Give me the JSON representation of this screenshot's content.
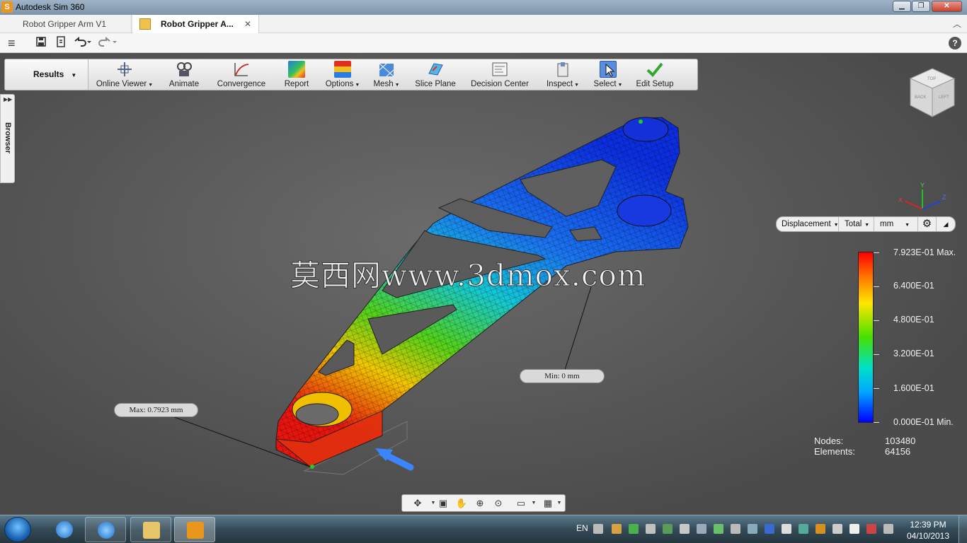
{
  "window": {
    "title": "Autodesk Sim 360",
    "minimize": "▁",
    "maximize": "❐",
    "close": "✕"
  },
  "tabs": [
    {
      "label": "Robot Gripper Arm V1"
    },
    {
      "label": "Robot Gripper A...",
      "close": "✕"
    }
  ],
  "quick_access": {
    "menu": "≡",
    "help": "?"
  },
  "ribbon": {
    "workspace": "Results",
    "items": [
      {
        "label": "Online Viewer",
        "dropdown": true
      },
      {
        "label": "Animate",
        "dropdown": false
      },
      {
        "label": "Convergence",
        "dropdown": false
      },
      {
        "label": "Report",
        "dropdown": false
      },
      {
        "label": "Options",
        "dropdown": true
      },
      {
        "label": "Mesh",
        "dropdown": true
      },
      {
        "label": "Slice Plane",
        "dropdown": false
      },
      {
        "label": "Decision Center",
        "dropdown": false
      },
      {
        "label": "Inspect",
        "dropdown": true
      },
      {
        "label": "Select",
        "dropdown": true
      },
      {
        "label": "Edit Setup",
        "dropdown": false
      }
    ]
  },
  "browser": {
    "label": "Browser"
  },
  "viewcube": {
    "top": "TOP",
    "front": "BACK",
    "right": "LEFT"
  },
  "legend_controls": {
    "result": "Displacement",
    "component": "Total",
    "unit": "mm"
  },
  "legend": {
    "labels": [
      "7.923E-01 Max.",
      "6.400E-01",
      "4.800E-01",
      "3.200E-01",
      "1.600E-01",
      "0.000E-01 Min."
    ],
    "colors": {
      "max": "#ff0000",
      "min": "#0000ff"
    }
  },
  "stats": {
    "nodes_label": "Nodes:",
    "nodes_value": "103480",
    "elements_label": "Elements:",
    "elements_value": "64156"
  },
  "probes": {
    "max": "Max: 0.7923 mm",
    "min": "Min: 0 mm"
  },
  "watermark": "莫西网www.3dmox.com",
  "taskbar": {
    "language": "EN",
    "time": "12:39 PM",
    "date": "04/10/2013"
  }
}
